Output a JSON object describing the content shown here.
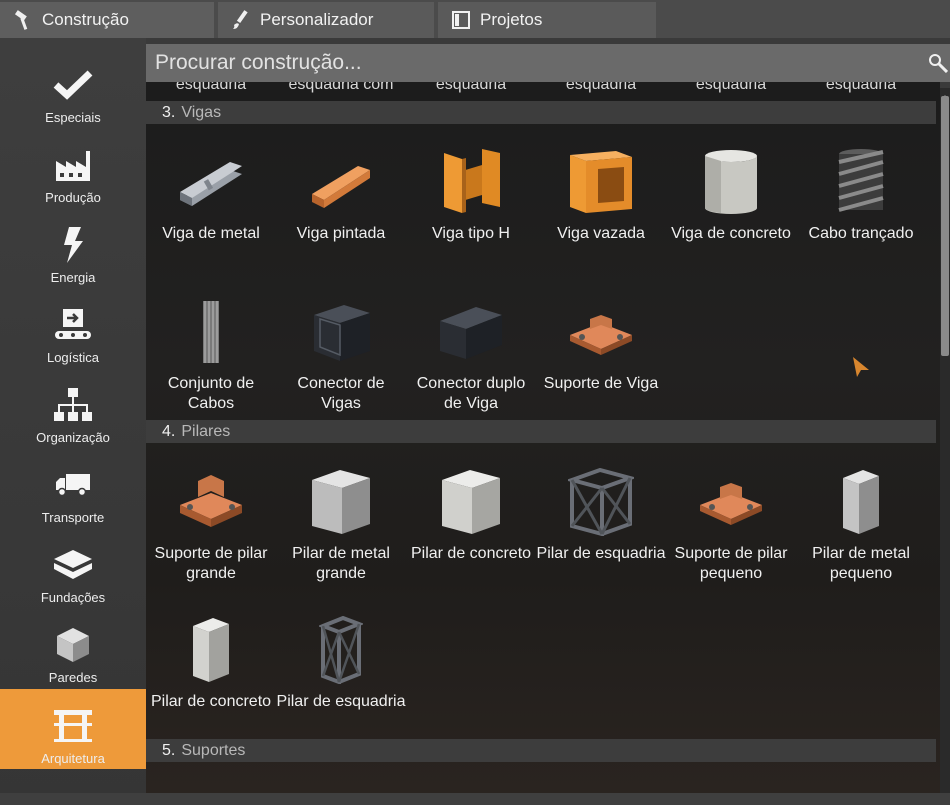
{
  "tabs": [
    {
      "label": "Construção",
      "icon": "hammer-icon"
    },
    {
      "label": "Personalizador",
      "icon": "brush-icon"
    },
    {
      "label": "Projetos",
      "icon": "blueprint-icon"
    }
  ],
  "sidebar": {
    "items": [
      {
        "label": "Especiais",
        "icon": "checkmark-icon"
      },
      {
        "label": "Produção",
        "icon": "factory-icon"
      },
      {
        "label": "Energia",
        "icon": "lightning-icon"
      },
      {
        "label": "Logística",
        "icon": "conveyor-icon"
      },
      {
        "label": "Organização",
        "icon": "hierarchy-icon"
      },
      {
        "label": "Transporte",
        "icon": "truck-icon"
      },
      {
        "label": "Fundações",
        "icon": "foundation-icon"
      },
      {
        "label": "Paredes",
        "icon": "wall-icon"
      },
      {
        "label": "Arquitetura",
        "icon": "architecture-icon",
        "active": true
      }
    ]
  },
  "search": {
    "placeholder": "Procurar construção..."
  },
  "cut_row": [
    "esquadria",
    "esquadria com",
    "esquadria",
    "esquadria",
    "esquadria",
    "esquadria"
  ],
  "sections": [
    {
      "number": "3.",
      "name": "Vigas",
      "items": [
        {
          "label": "Viga de metal",
          "icon": "metal-beam-icon"
        },
        {
          "label": "Viga pintada",
          "icon": "painted-beam-icon"
        },
        {
          "label": "Viga tipo H",
          "icon": "h-beam-icon"
        },
        {
          "label": "Viga vazada",
          "icon": "hollow-beam-icon"
        },
        {
          "label": "Viga de concreto",
          "icon": "concrete-beam-icon"
        },
        {
          "label": "Cabo trançado",
          "icon": "braided-cable-icon"
        },
        {
          "label": "Conjunto de Cabos",
          "icon": "cable-bundle-icon"
        },
        {
          "label": "Conector de Vigas",
          "icon": "beam-connector-icon"
        },
        {
          "label": "Conector duplo de Viga",
          "icon": "double-beam-connector-icon"
        },
        {
          "label": "Suporte de Viga",
          "icon": "beam-support-icon"
        }
      ]
    },
    {
      "number": "4.",
      "name": "Pilares",
      "items": [
        {
          "label": "Suporte de pilar grande",
          "icon": "large-pillar-support-icon"
        },
        {
          "label": "Pilar de metal grande",
          "icon": "large-metal-pillar-icon"
        },
        {
          "label": "Pilar de concreto",
          "icon": "concrete-pillar-icon"
        },
        {
          "label": "Pilar de esquadria",
          "icon": "frame-pillar-icon"
        },
        {
          "label": "Suporte de pilar pequeno",
          "icon": "small-pillar-support-icon"
        },
        {
          "label": "Pilar de metal pequeno",
          "icon": "small-metal-pillar-icon"
        },
        {
          "label": "Pilar de concreto",
          "icon": "concrete-pillar-icon"
        },
        {
          "label": "Pilar de esquadria",
          "icon": "frame-pillar-icon"
        }
      ]
    },
    {
      "number": "5.",
      "name": "Suportes",
      "items": []
    }
  ],
  "colors": {
    "accent": "#ee9a3a",
    "tab_bg": "#5a5a5a",
    "sidebar_bg": "#3a3a3a",
    "section_header": "#3d3d3d"
  }
}
